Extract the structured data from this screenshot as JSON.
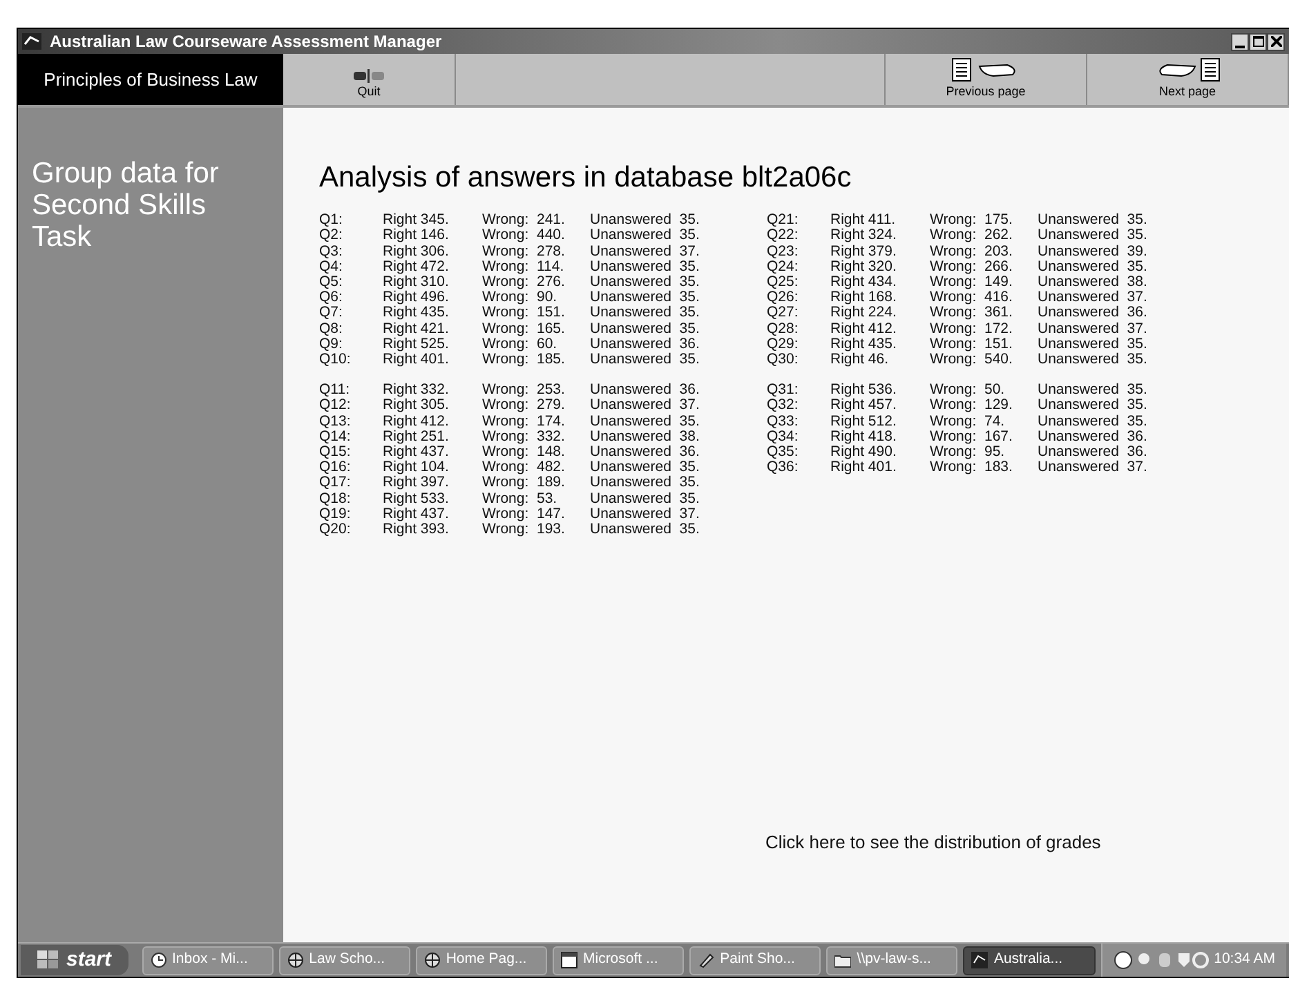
{
  "window": {
    "title": "Australian Law Courseware Assessment Manager"
  },
  "toolbar": {
    "course": "Principles of Business Law",
    "buttons": [
      {
        "label": "Quit",
        "kind": "quit"
      },
      {
        "label": "Previous page",
        "kind": "prev"
      },
      {
        "label": "Next page",
        "kind": "next"
      }
    ]
  },
  "sidebar": {
    "heading": "Group data for Second Skills Task"
  },
  "heading": "Analysis of answers in database blt2a06c",
  "columns": [
    {
      "blocks": [
        {
          "rows": [
            {
              "q": "Q1:",
              "right": "Right 345.",
              "wrong": "Wrong:  241.",
              "unanswered": "Unanswered  35."
            },
            {
              "q": "Q2:",
              "right": "Right 146.",
              "wrong": "Wrong:  440.",
              "unanswered": "Unanswered  35."
            },
            {
              "q": "Q3:",
              "right": "Right 306.",
              "wrong": "Wrong:  278.",
              "unanswered": "Unanswered  37."
            },
            {
              "q": "Q4:",
              "right": "Right 472.",
              "wrong": "Wrong:  114.",
              "unanswered": "Unanswered  35."
            },
            {
              "q": "Q5:",
              "right": "Right 310.",
              "wrong": "Wrong:  276.",
              "unanswered": "Unanswered  35."
            },
            {
              "q": "Q6:",
              "right": "Right 496.",
              "wrong": "Wrong:  90.",
              "unanswered": "Unanswered  35."
            },
            {
              "q": "Q7:",
              "right": "Right 435.",
              "wrong": "Wrong:  151.",
              "unanswered": "Unanswered  35."
            },
            {
              "q": "Q8:",
              "right": "Right 421.",
              "wrong": "Wrong:  165.",
              "unanswered": "Unanswered  35."
            },
            {
              "q": "Q9:",
              "right": "Right 525.",
              "wrong": "Wrong:  60.",
              "unanswered": "Unanswered  36."
            },
            {
              "q": "Q10:",
              "right": "Right 401.",
              "wrong": "Wrong:  185.",
              "unanswered": "Unanswered  35."
            }
          ]
        },
        {
          "rows": [
            {
              "q": "Q11:",
              "right": "Right 332.",
              "wrong": "Wrong:  253.",
              "unanswered": "Unanswered  36."
            },
            {
              "q": "Q12:",
              "right": "Right 305.",
              "wrong": "Wrong:  279.",
              "unanswered": "Unanswered  37."
            },
            {
              "q": "Q13:",
              "right": "Right 412.",
              "wrong": "Wrong:  174.",
              "unanswered": "Unanswered  35."
            },
            {
              "q": "Q14:",
              "right": "Right 251.",
              "wrong": "Wrong:  332.",
              "unanswered": "Unanswered  38."
            },
            {
              "q": "Q15:",
              "right": "Right 437.",
              "wrong": "Wrong:  148.",
              "unanswered": "Unanswered  36."
            },
            {
              "q": "Q16:",
              "right": "Right 104.",
              "wrong": "Wrong:  482.",
              "unanswered": "Unanswered  35."
            },
            {
              "q": "Q17:",
              "right": "Right 397.",
              "wrong": "Wrong:  189.",
              "unanswered": "Unanswered  35."
            },
            {
              "q": "Q18:",
              "right": "Right 533.",
              "wrong": "Wrong:  53.",
              "unanswered": "Unanswered  35."
            },
            {
              "q": "Q19:",
              "right": "Right 437.",
              "wrong": "Wrong:  147.",
              "unanswered": "Unanswered  37."
            },
            {
              "q": "Q20:",
              "right": "Right 393.",
              "wrong": "Wrong:  193.",
              "unanswered": "Unanswered  35."
            }
          ]
        }
      ]
    },
    {
      "blocks": [
        {
          "rows": [
            {
              "q": "Q21:",
              "right": "Right 411.",
              "wrong": "Wrong:  175.",
              "unanswered": "Unanswered  35."
            },
            {
              "q": "Q22:",
              "right": "Right 324.",
              "wrong": "Wrong:  262.",
              "unanswered": "Unanswered  35."
            },
            {
              "q": "Q23:",
              "right": "Right 379.",
              "wrong": "Wrong:  203.",
              "unanswered": "Unanswered  39."
            },
            {
              "q": "Q24:",
              "right": "Right 320.",
              "wrong": "Wrong:  266.",
              "unanswered": "Unanswered  35."
            },
            {
              "q": "Q25:",
              "right": "Right 434.",
              "wrong": "Wrong:  149.",
              "unanswered": "Unanswered  38."
            },
            {
              "q": "Q26:",
              "right": "Right 168.",
              "wrong": "Wrong:  416.",
              "unanswered": "Unanswered  37."
            },
            {
              "q": "Q27:",
              "right": "Right 224.",
              "wrong": "Wrong:  361.",
              "unanswered": "Unanswered  36."
            },
            {
              "q": "Q28:",
              "right": "Right 412.",
              "wrong": "Wrong:  172.",
              "unanswered": "Unanswered  37."
            },
            {
              "q": "Q29:",
              "right": "Right 435.",
              "wrong": "Wrong:  151.",
              "unanswered": "Unanswered  35."
            },
            {
              "q": "Q30:",
              "right": "Right 46.",
              "wrong": "Wrong:  540.",
              "unanswered": "Unanswered  35."
            }
          ]
        },
        {
          "rows": [
            {
              "q": "Q31:",
              "right": "Right 536.",
              "wrong": "Wrong:  50.",
              "unanswered": "Unanswered  35."
            },
            {
              "q": "Q32:",
              "right": "Right 457.",
              "wrong": "Wrong:  129.",
              "unanswered": "Unanswered  35."
            },
            {
              "q": "Q33:",
              "right": "Right 512.",
              "wrong": "Wrong:  74.",
              "unanswered": "Unanswered  35."
            },
            {
              "q": "Q34:",
              "right": "Right 418.",
              "wrong": "Wrong:  167.",
              "unanswered": "Unanswered  36."
            },
            {
              "q": "Q35:",
              "right": "Right 490.",
              "wrong": "Wrong:  95.",
              "unanswered": "Unanswered  36."
            },
            {
              "q": "Q36:",
              "right": "Right 401.",
              "wrong": "Wrong:  183.",
              "unanswered": "Unanswered  37."
            }
          ]
        }
      ]
    }
  ],
  "distribution_link": "Click here to see the distribution of grades",
  "taskbar": {
    "start": "start",
    "tasks": [
      {
        "label": "Inbox - Mi...",
        "kind": "clock",
        "selected": false
      },
      {
        "label": "Law Scho...",
        "kind": "browser",
        "selected": false
      },
      {
        "label": "Home Pag...",
        "kind": "browser",
        "selected": false
      },
      {
        "label": "Microsoft ...",
        "kind": "window",
        "selected": false
      },
      {
        "label": "Paint Sho...",
        "kind": "paint",
        "selected": false
      },
      {
        "label": "\\\\pv-law-s...",
        "kind": "folder",
        "selected": false
      },
      {
        "label": "Australia...",
        "kind": "app",
        "selected": true
      }
    ],
    "clock": "10:34 AM"
  }
}
